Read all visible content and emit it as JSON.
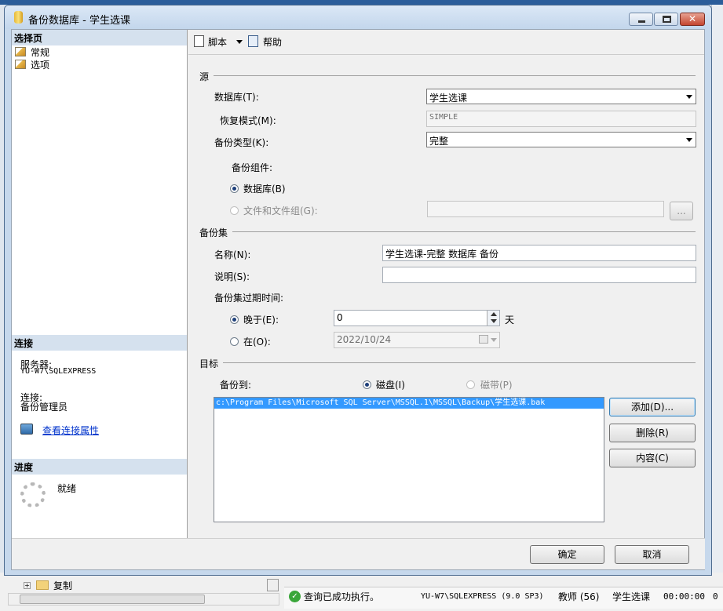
{
  "window": {
    "title": "备份数据库 - 学生选课"
  },
  "sidebar": {
    "select_page_header": "选择页",
    "items": [
      {
        "label": "常规"
      },
      {
        "label": "选项"
      }
    ],
    "connection_header": "连接",
    "server_label": "服务器:",
    "server_value": "YU-W7\\SQLEXPRESS",
    "connection_label": "连接:",
    "connection_value": "备份管理员",
    "view_props_link": "查看连接属性",
    "progress_header": "进度",
    "progress_status": "就绪"
  },
  "toolbar": {
    "script_label": "脚本",
    "help_label": "帮助"
  },
  "source": {
    "group_label": "源",
    "database_label": "数据库(T):",
    "database_value": "学生选课",
    "recovery_label": "恢复模式(M):",
    "recovery_value": "SIMPLE",
    "backup_type_label": "备份类型(K):",
    "backup_type_value": "完整",
    "component_label": "备份组件:",
    "component_db": "数据库(B)",
    "component_files": "文件和文件组(G):",
    "browse_label": "..."
  },
  "backup_set": {
    "group_label": "备份集",
    "name_label": "名称(N):",
    "name_value": "学生选课-完整 数据库 备份",
    "desc_label": "说明(S):",
    "desc_value": "",
    "expire_label": "备份集过期时间:",
    "after_label": "晚于(E):",
    "after_value": "0",
    "days_unit": "天",
    "on_label": "在(O):",
    "on_value": "2022/10/24"
  },
  "destination": {
    "group_label": "目标",
    "backup_to_label": "备份到:",
    "disk_label": "磁盘(I)",
    "tape_label": "磁带(P)",
    "files": [
      "c:\\Program Files\\Microsoft SQL Server\\MSSQL.1\\MSSQL\\Backup\\学生选课.bak"
    ],
    "add_button": "添加(D)...",
    "remove_button": "删除(R)",
    "contents_button": "内容(C)"
  },
  "footer": {
    "ok_button": "确定",
    "cancel_button": "取消"
  },
  "background": {
    "tree_item": "复制",
    "status_message": "查询已成功执行。",
    "status_server": "YU-W7\\SQLEXPRESS (9.0 SP3)",
    "status_user": "教师 (56)",
    "status_db": "学生选课",
    "status_time": "00:00:00",
    "status_rows": "0"
  },
  "colors": {
    "section_header": "#d5e1ee",
    "title_bar": "#c3d6ec",
    "selection": "#3399ff",
    "link": "#0033cc"
  }
}
